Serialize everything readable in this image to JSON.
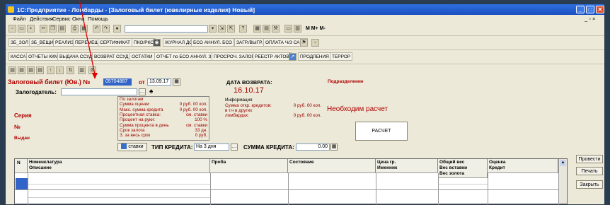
{
  "window": {
    "title": "1С:Предприятие - Ломбарды - [Залоговый билет (ювелирные изделия) Новый]"
  },
  "menu": [
    "Файл",
    "Действия",
    "Сервис",
    "Окна",
    "Помощь"
  ],
  "toolbar1": {
    "search_value": "",
    "icons_text": "M  M+  M-"
  },
  "toolbar2": [
    "ЗБ_ЗОЛ",
    "ЗБ_ВЕЩИ",
    "РЕАЛИЗ",
    "ПЕРЕМЕЩ",
    "СЕРТИФИКАТ",
    "ПКО/РКО",
    "ЖУРНАЛ ДОК.",
    "БСО АННУЛ. БСО",
    "ЗАГР./ВЫГР.",
    "ОПЛАТА Ч/З САЙТ"
  ],
  "toolbar3": [
    "КАССА",
    "ОТЧЕТЫ ККМ",
    "ВЫДАЧА ССУД",
    "ВОЗВРАТ ССУД",
    "ОСТАТКИ",
    "ОТЧЕТ по БСО АННУЛ. ЗБ",
    "ПРОСРОЧ. ЗАЛОГИ",
    "РЕЕСТР АКТОВ",
    "ПРОДЛЕНИЯ",
    "ТЕРРОР"
  ],
  "form": {
    "title": "Залоговый билет (Юв.) №",
    "number": "05704887",
    "from_label": "от",
    "date": "13.09.17",
    "return_label": "ДАТА ВОЗВРАТА:",
    "return_date": "16.10.17",
    "subdivision_label": "Подразделение",
    "pledger_label": "Залогодатель:",
    "series_label": "Серия",
    "num_label": "№",
    "issued_label": "Выдан",
    "pledge_info": [
      [
        "По залогам",
        ""
      ],
      [
        "Сумма оценки",
        "0 руб. 00 коп."
      ],
      [
        "Макс. сумма кредита",
        "0 руб. 00 коп."
      ],
      [
        "Процентная ставка:",
        "см. ставки"
      ],
      [
        "Процент на руки:",
        "100 %"
      ],
      [
        "Сумма процента в день",
        "см. ставки"
      ],
      [
        "Срок залога",
        "33 дн."
      ],
      [
        "З. за весь срок",
        "0 руб."
      ]
    ],
    "info_title": "Информация",
    "info_rows": [
      [
        "Сумма откр. кредитов:",
        "0 руб. 00 коп."
      ],
      [
        "в т.ч в других",
        ""
      ],
      [
        "ломбардах:",
        "0 руб. 00 коп."
      ]
    ],
    "need_calc": "Необходим расчет",
    "calc_button": "РАСЧЕТ",
    "rates_button": "ставки",
    "credit_type_label": "ТИП КРЕДИТА:",
    "credit_type_value": "На 3 дня",
    "credit_sum_label": "СУММА КРЕДИТА:",
    "credit_sum_value": "0.00"
  },
  "table": {
    "headers": {
      "n": "N",
      "nomenclature": "Номенклатура",
      "description": "Описание",
      "assay": "Проба",
      "state": "Состояние",
      "price": "Цена гр.",
      "item": "Именник",
      "total_weight": "Общий вес",
      "insert_weight": "Вес вставки",
      "gold_weight": "Вес золота",
      "valuation": "Оценка",
      "credit": "Кредит"
    }
  },
  "side_buttons": [
    "Провести",
    "Печать",
    "Закрыть"
  ]
}
